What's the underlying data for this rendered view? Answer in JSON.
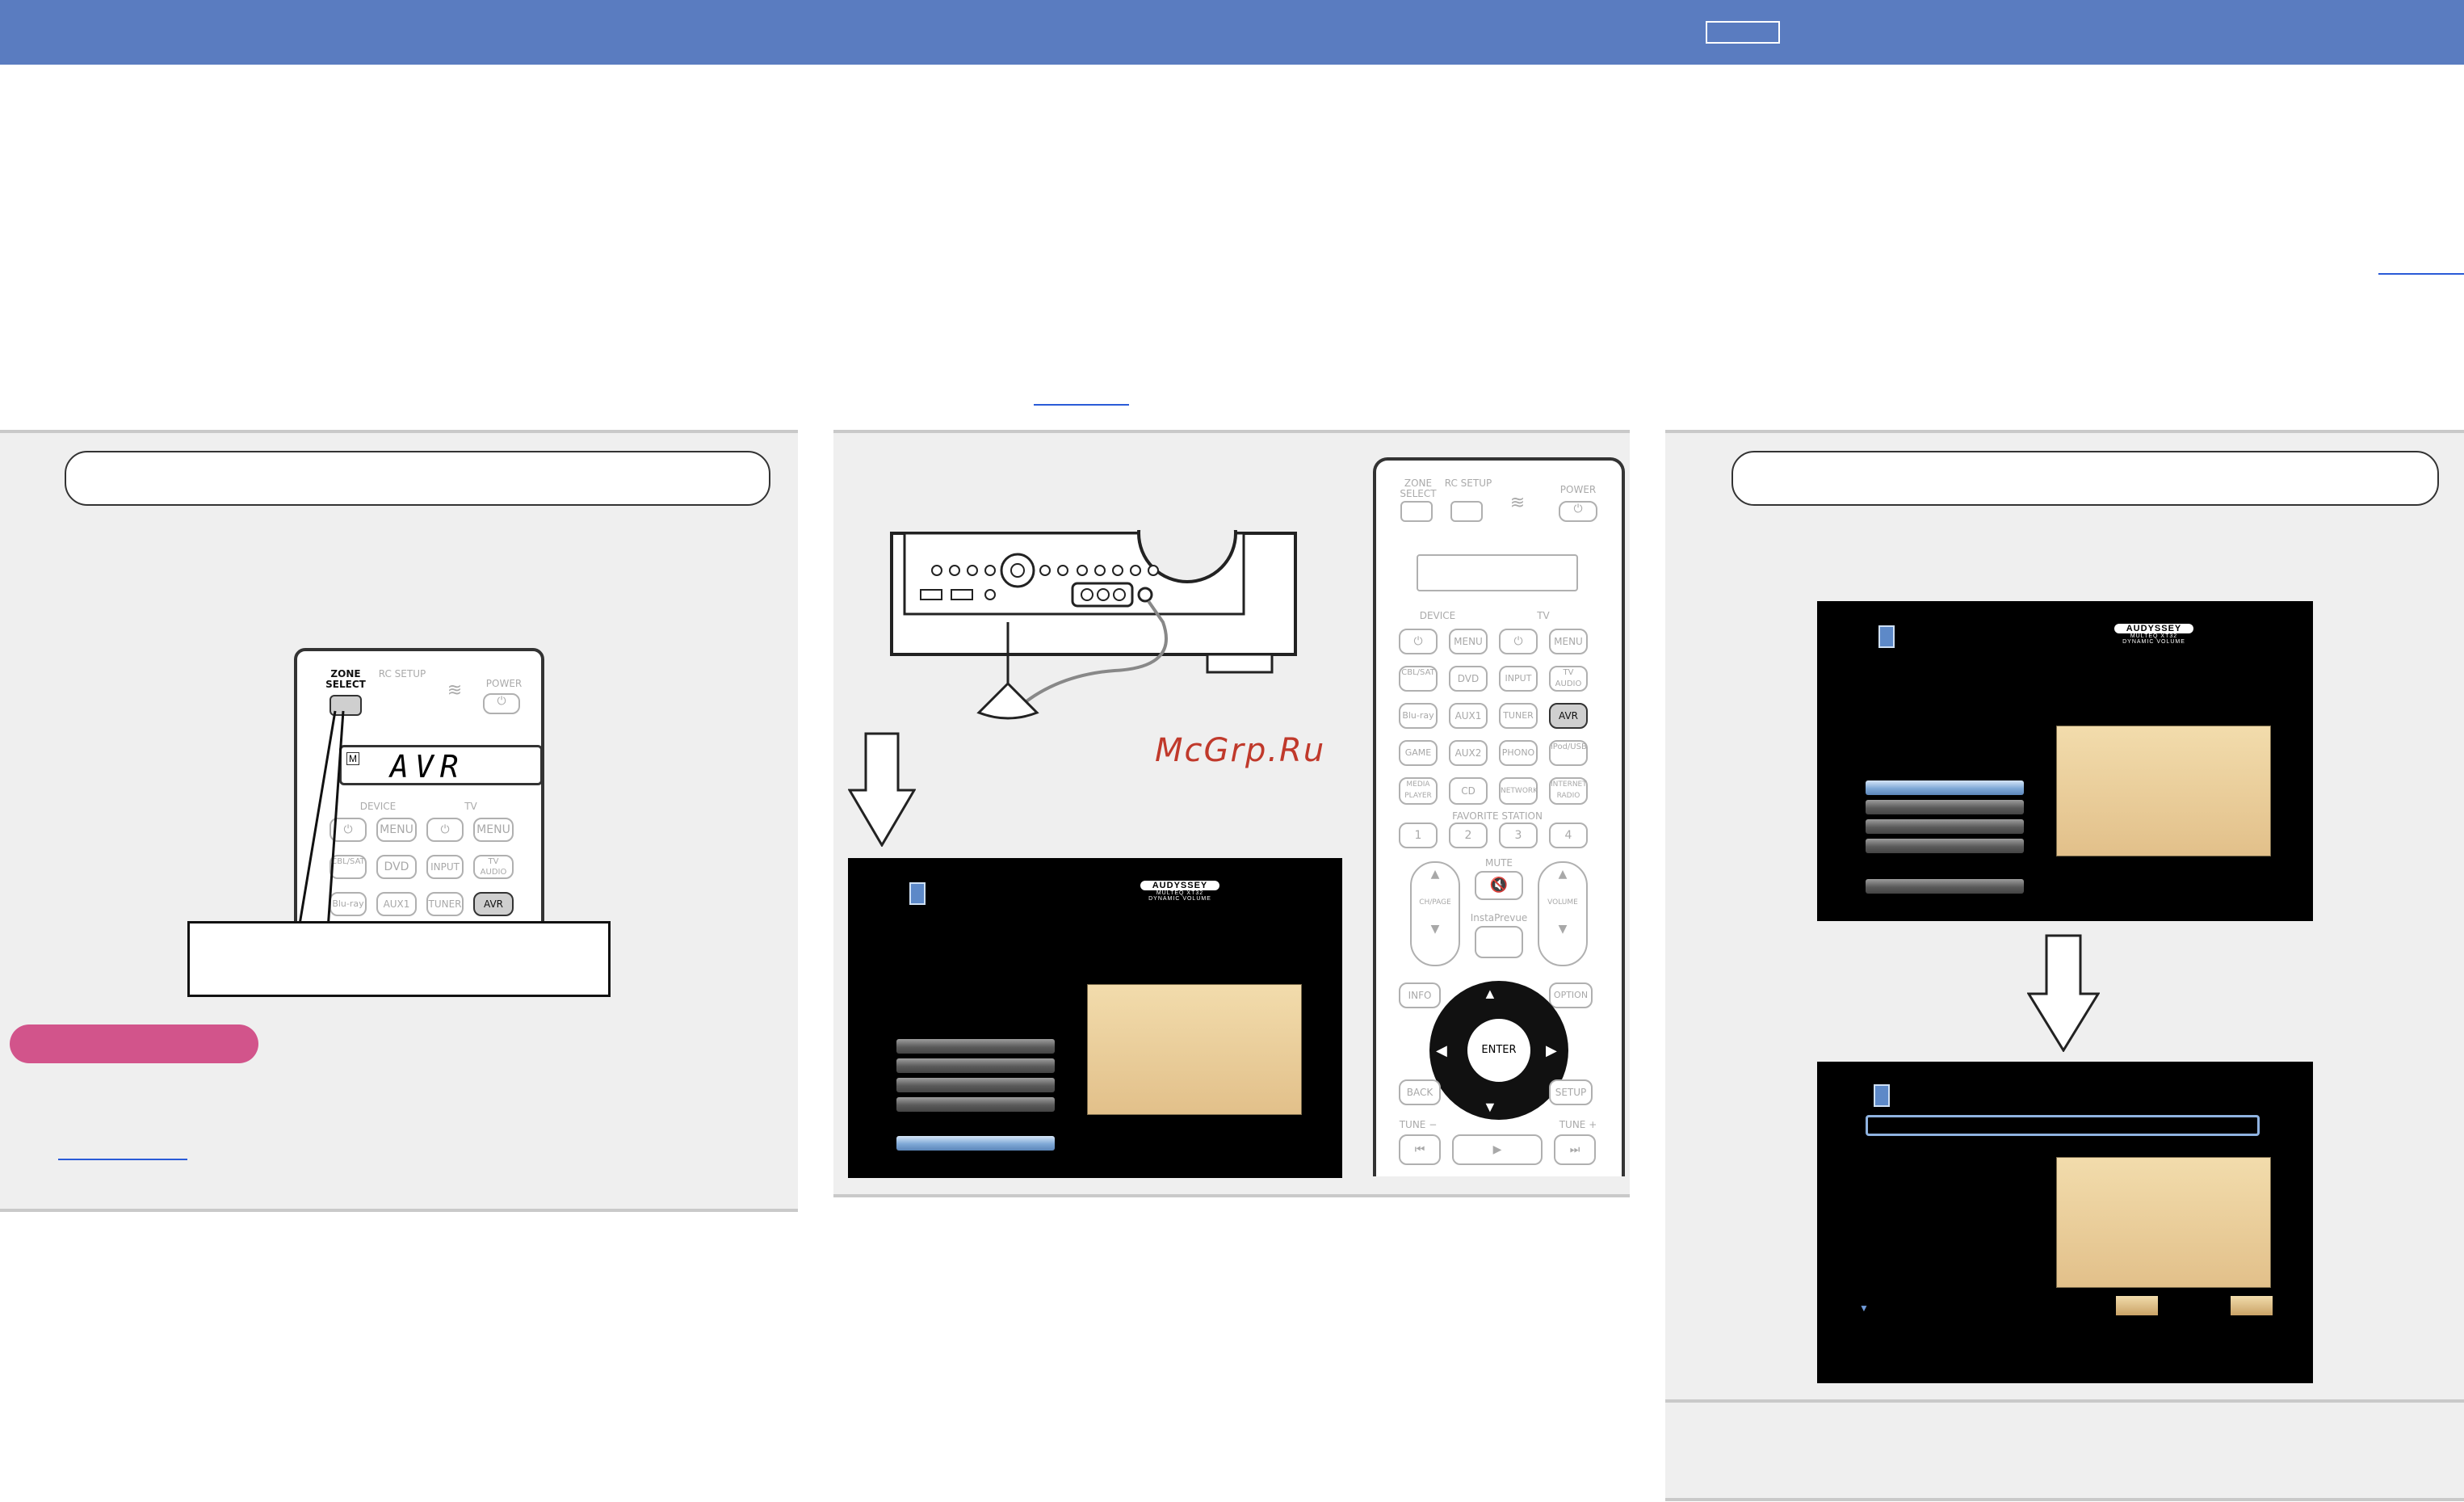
{
  "watermark": "McGrp.Ru",
  "remote_small": {
    "zone_select": "ZONE SELECT",
    "rc_setup": "RC SETUP",
    "power": "POWER",
    "lcd": "AVR",
    "lcd_badge": "M",
    "device": "DEVICE",
    "tv": "TV",
    "row1": [
      "⏻",
      "MENU",
      "⏻",
      "MENU"
    ],
    "row2": [
      "CBL/SAT",
      "DVD",
      "INPUT",
      "TV AUDIO"
    ],
    "row3": [
      "Blu-ray",
      "AUX1",
      "TUNER",
      "AVR"
    ]
  },
  "remote_large": {
    "zone_select": "ZONE SELECT",
    "rc_setup": "RC SETUP",
    "power": "POWER",
    "device": "DEVICE",
    "tv": "TV",
    "row1": [
      "⏻",
      "MENU",
      "⏻",
      "MENU"
    ],
    "row2": [
      "CBL/SAT",
      "DVD",
      "INPUT",
      "TV AUDIO"
    ],
    "row3": [
      "Blu-ray",
      "AUX1",
      "TUNER",
      "AVR"
    ],
    "row4": [
      "GAME",
      "AUX2",
      "PHONO",
      "iPod/USB"
    ],
    "row5": [
      "MEDIA PLAYER",
      "CD",
      "NETWORK",
      "INTERNET RADIO"
    ],
    "favorite_station": "FAVORITE STATION",
    "row6": [
      "1",
      "2",
      "3",
      "4"
    ],
    "mute": "MUTE",
    "ch_page": "CH/PAGE",
    "insta_preview": "InstaPrevue",
    "volume": "VOLUME",
    "info": "INFO",
    "option": "OPTION",
    "enter": "ENTER",
    "back": "BACK",
    "setup": "SETUP",
    "tune_minus": "TUNE −",
    "tune_plus": "TUNE +"
  },
  "audyssey": {
    "logo": "AUDYSSEY",
    "sub1": "MULTEQ XT32",
    "sub2": "DYNAMIC VOLUME"
  }
}
